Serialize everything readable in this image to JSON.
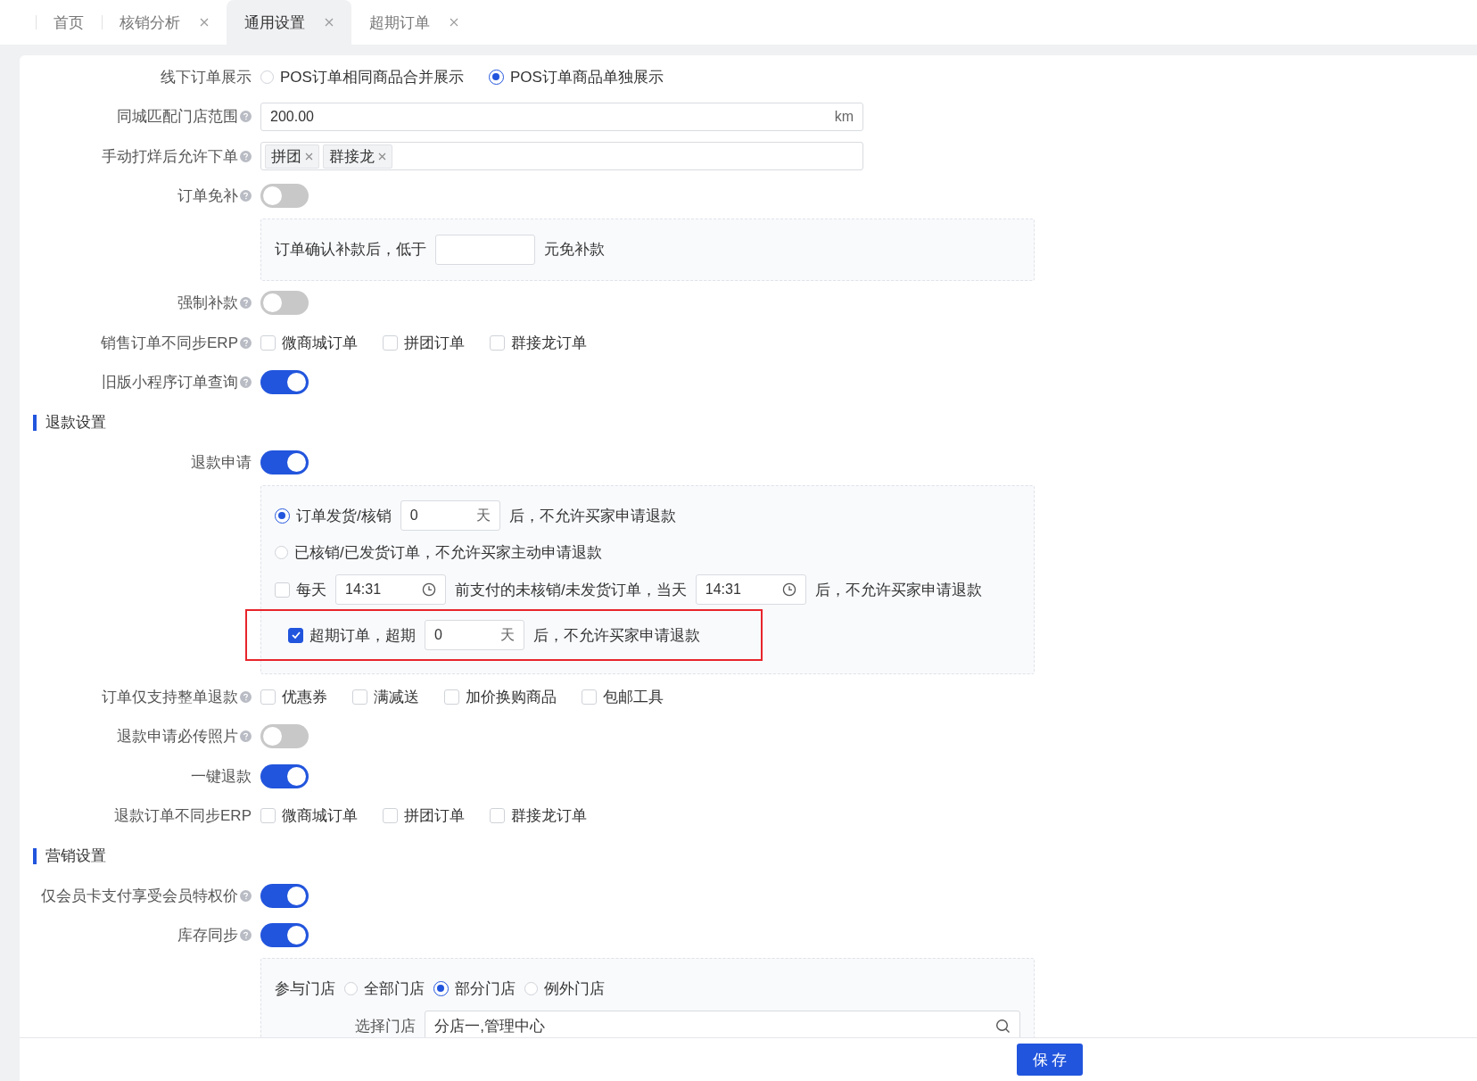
{
  "tabs": [
    {
      "label": "首页",
      "closable": false,
      "selected": false
    },
    {
      "label": "核销分析",
      "closable": true,
      "selected": false
    },
    {
      "label": "通用设置",
      "closable": true,
      "selected": true
    },
    {
      "label": "超期订单",
      "closable": true,
      "selected": false
    }
  ],
  "items": [
    {
      "kind": "radio",
      "label": "线下订单展示",
      "help": false,
      "options": [
        {
          "label": "POS订单相同商品合并展示",
          "selected": false
        },
        {
          "label": "POS订单商品单独展示",
          "selected": true
        }
      ]
    },
    {
      "kind": "input",
      "label": "同城匹配门店范围",
      "help": true,
      "value": "200.00",
      "suffix": "km"
    },
    {
      "kind": "tags",
      "label": "手动打烊后允许下单",
      "help": true,
      "tags": [
        "拼团",
        "群接龙"
      ]
    },
    {
      "kind": "switch",
      "label": "订单免补",
      "help": true,
      "on": false
    },
    {
      "kind": "panel",
      "rows": [
        {
          "parts": [
            {
              "kind": "text",
              "text": "订单确认补款后，低于"
            },
            {
              "kind": "input"
            },
            {
              "kind": "text",
              "text": "元免补款"
            }
          ]
        }
      ]
    },
    {
      "kind": "switch",
      "label": "强制补款",
      "help": true,
      "on": false
    },
    {
      "kind": "checkboxes",
      "label": "销售订单不同步ERP",
      "help": true,
      "options": [
        {
          "label": "微商城订单",
          "checked": false
        },
        {
          "label": "拼团订单",
          "checked": false
        },
        {
          "label": "群接龙订单",
          "checked": false
        }
      ]
    },
    {
      "kind": "switch",
      "label": "旧版小程序订单查询",
      "help": true,
      "on": true
    },
    {
      "kind": "heading",
      "title": "退款设置"
    },
    {
      "kind": "switch",
      "label": "退款申请",
      "help": false,
      "on": true
    },
    {
      "kind": "panel",
      "rows": [
        {
          "parts": [
            {
              "kind": "radio",
              "label": "订单发货/核销",
              "selected": true
            },
            {
              "kind": "input",
              "value": "0",
              "suffix": "天"
            },
            {
              "kind": "text",
              "text": "后，不允许买家申请退款"
            }
          ]
        },
        {
          "parts": [
            {
              "kind": "radio",
              "label": "已核销/已发货订单，不允许买家主动申请退款",
              "selected": false
            }
          ]
        },
        {
          "parts": [
            {
              "kind": "checkbox",
              "label": "每天",
              "checked": false
            },
            {
              "kind": "time",
              "value": "14:31"
            },
            {
              "kind": "text",
              "text": "前支付的未核销/未发货订单，当天"
            },
            {
              "kind": "time",
              "value": "14:31"
            },
            {
              "kind": "text",
              "text": "后，不允许买家申请退款"
            }
          ]
        },
        {
          "highlighted": true,
          "parts": [
            {
              "kind": "checkbox",
              "label": "超期订单，超期",
              "checked": true
            },
            {
              "kind": "input",
              "value": "0",
              "suffix": "天"
            },
            {
              "kind": "text",
              "text": "后，不允许买家申请退款"
            }
          ]
        }
      ]
    },
    {
      "kind": "checkboxes",
      "label": "订单仅支持整单退款",
      "help": true,
      "options": [
        {
          "label": "优惠券",
          "checked": false
        },
        {
          "label": "满减送",
          "checked": false
        },
        {
          "label": "加价换购商品",
          "checked": false
        },
        {
          "label": "包邮工具",
          "checked": false
        }
      ]
    },
    {
      "kind": "switch",
      "label": "退款申请必传照片",
      "help": true,
      "on": false
    },
    {
      "kind": "switch",
      "label": "一键退款",
      "help": false,
      "on": true
    },
    {
      "kind": "checkboxes",
      "label": "退款订单不同步ERP",
      "help": false,
      "options": [
        {
          "label": "微商城订单",
          "checked": false
        },
        {
          "label": "拼团订单",
          "checked": false
        },
        {
          "label": "群接龙订单",
          "checked": false
        }
      ]
    },
    {
      "kind": "heading",
      "title": "营销设置"
    },
    {
      "kind": "switch",
      "label": "仅会员卡支付享受会员特权价",
      "help": true,
      "on": true
    },
    {
      "kind": "switch",
      "label": "库存同步",
      "help": true,
      "on": true
    },
    {
      "kind": "panel",
      "rows": [
        {
          "parts": [
            {
              "kind": "label",
              "text": "参与门店"
            },
            {
              "kind": "radio",
              "label": "全部门店",
              "selected": false
            },
            {
              "kind": "radio",
              "label": "部分门店",
              "selected": true
            },
            {
              "kind": "radio",
              "label": "例外门店",
              "selected": false
            }
          ]
        },
        {
          "parts": [
            {
              "kind": "field-label",
              "text": "选择门店"
            },
            {
              "kind": "search",
              "value": "分店一,管理中心"
            }
          ]
        }
      ]
    }
  ],
  "footer": {
    "save": "保 存"
  }
}
